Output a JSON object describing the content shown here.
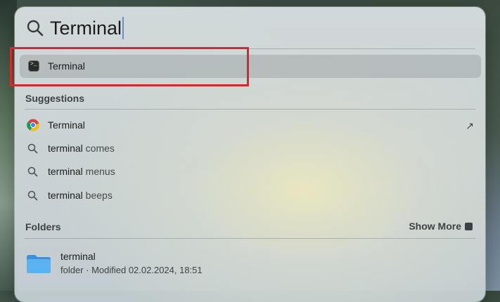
{
  "search": {
    "query": "Terminal"
  },
  "top_hit": {
    "label": "Terminal",
    "icon": "terminal-app-icon"
  },
  "suggestions": {
    "title": "Suggestions",
    "items": [
      {
        "bold": "Terminal",
        "rest": "",
        "icon": "chrome-icon"
      },
      {
        "bold": "terminal",
        "rest": " comes",
        "icon": "search-icon"
      },
      {
        "bold": "terminal",
        "rest": " menus",
        "icon": "search-icon"
      },
      {
        "bold": "terminal",
        "rest": " beeps",
        "icon": "search-icon"
      }
    ]
  },
  "folders": {
    "title": "Folders",
    "show_more": "Show More",
    "items": [
      {
        "name": "terminal",
        "subtitle": "folder · Modified 02.02.2024, 18:51",
        "icon": "folder-icon"
      }
    ]
  },
  "colors": {
    "highlight_box": "#d62a2a",
    "folder_blue": "#4aa3e8"
  }
}
